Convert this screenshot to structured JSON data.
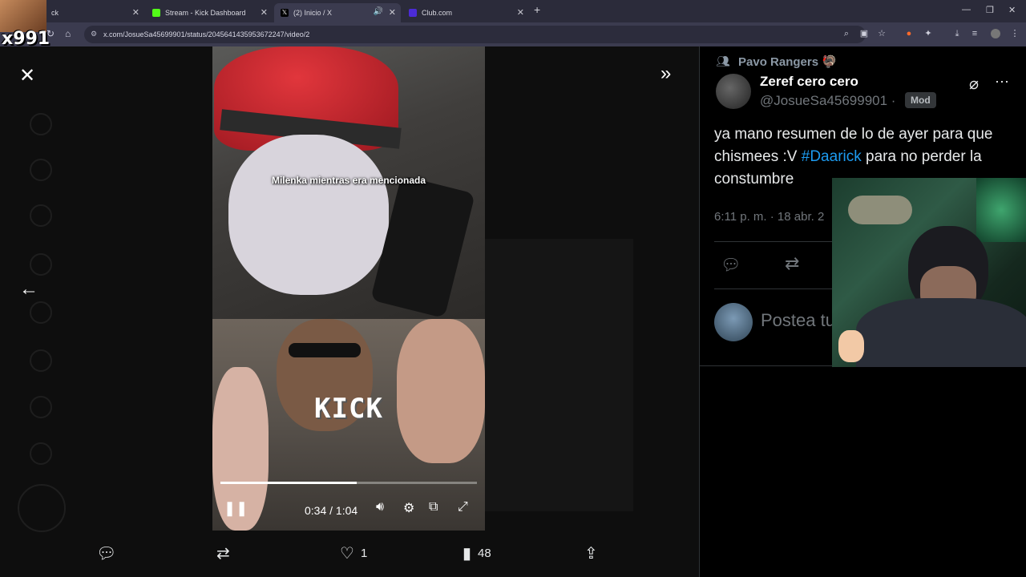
{
  "browser": {
    "tabs": [
      {
        "label": "ck",
        "favicon_color": "#7a7a7a",
        "active": false
      },
      {
        "label": "Stream - Kick Dashboard",
        "favicon_color": "#53fc18",
        "active": false
      },
      {
        "label": "(2) Inicio / X",
        "favicon_color": "#000000",
        "active": true
      },
      {
        "label": "Club.com",
        "favicon_color": "#4b2bd6",
        "active": false
      }
    ],
    "url": "x.com/JosueSa45699901/status/2045641435953672247/video/2"
  },
  "overlay": {
    "streamer_tag": "x991"
  },
  "viewer": {
    "video_caption": "Milenka mientras era mencionada",
    "video_logo": "KICK",
    "time_display": "0:34 / 1:04",
    "progress_fraction": 0.53,
    "actions": {
      "like_count": "1",
      "views_count": "48"
    }
  },
  "panel": {
    "community": "Pavo Rangers 🦃",
    "display_name": "Zeref cero cero",
    "handle": "@JosueSa45699901 ·",
    "badge": "Mod",
    "tweet_before": "ya mano resumen de lo de ayer para que chismees :V ",
    "hashtag": "#Daarick",
    "tweet_after": " para no perder la constumbre",
    "timestamp": "6:11 p. m. · 18 abr. 2",
    "reply_placeholder": "Postea tu respuesta"
  },
  "colors": {
    "accent": "#1d9bf0",
    "background": "#000000",
    "muted": "#71767b"
  }
}
